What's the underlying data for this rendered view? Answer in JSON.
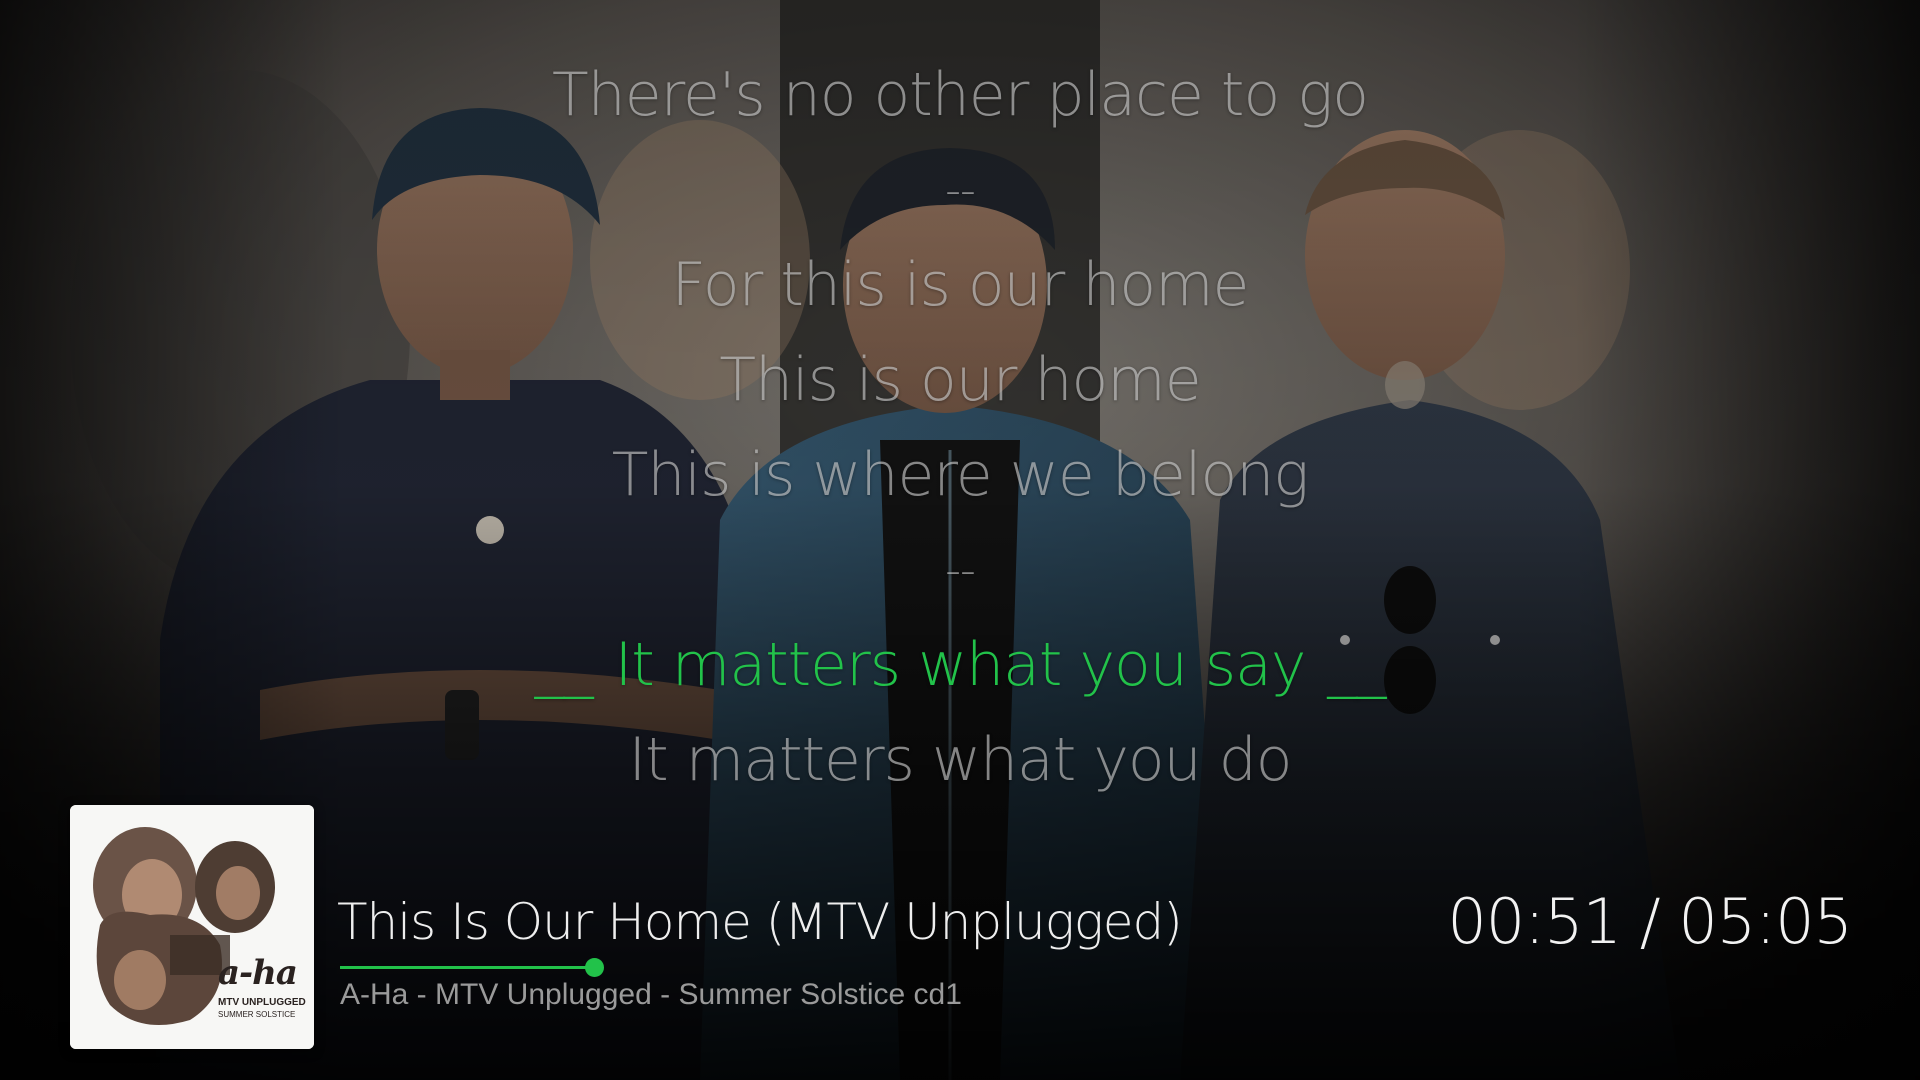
{
  "lyrics": {
    "lines": [
      {
        "text": "There's no other place to go"
      },
      {
        "text": "--"
      },
      {
        "text": "For this is our home"
      },
      {
        "text": "This is our home"
      },
      {
        "text": "This is where we belong"
      },
      {
        "text": "--"
      },
      {
        "text": "It matters what you say"
      },
      {
        "text": "It matters what you do"
      }
    ],
    "active_marker_left": "__",
    "active_marker_right": "__",
    "active_index": 6
  },
  "now_playing": {
    "title": "This Is Our Home (MTV Unplugged)",
    "subtitle": "A-Ha - MTV Unplugged - Summer Solstice cd1",
    "elapsed": "00:51",
    "separator": " / ",
    "duration": "05:05",
    "progress_fraction": 0.167
  },
  "album_cover": {
    "artist_logo": "a-ha",
    "badge": "MTV UNPLUGGED",
    "caption": "SUMMER SOLSTICE"
  },
  "colors": {
    "accent": "#22c24a",
    "lyric_dim": "#d2d2d2",
    "subtitle": "#9a9a9a"
  }
}
